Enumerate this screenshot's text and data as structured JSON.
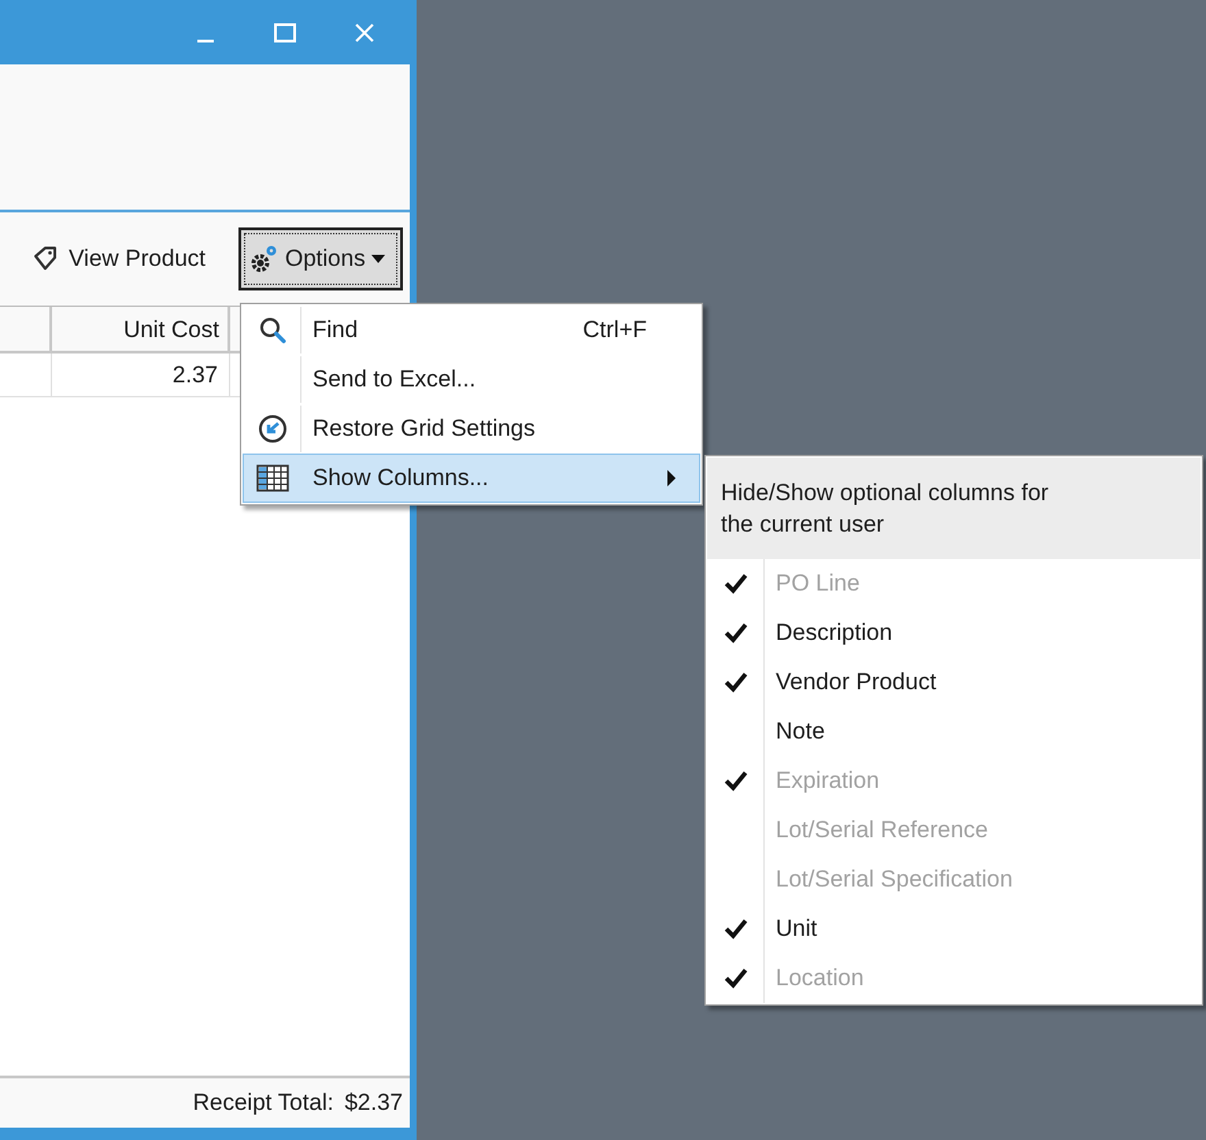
{
  "window": {
    "buttons": [
      {
        "kind": "minimize"
      },
      {
        "kind": "maximize"
      },
      {
        "kind": "close"
      }
    ]
  },
  "toolbar": {
    "view_product": "View Product",
    "options": "Options"
  },
  "grid": {
    "columns": [
      "Unit Cost"
    ],
    "rows": [
      [
        "2.37"
      ]
    ]
  },
  "status_bar": {
    "label": "Receipt Total:",
    "value": "$2.37"
  },
  "options_menu": [
    {
      "kind": "find",
      "label": "Find",
      "shortcut": "Ctrl+F",
      "selected": false,
      "submenu": false
    },
    {
      "kind": "none",
      "label": "Send to Excel...",
      "selected": false,
      "submenu": false
    },
    {
      "kind": "restore",
      "label": "Restore Grid Settings",
      "selected": false,
      "submenu": false
    },
    {
      "kind": "columns",
      "label": "Show Columns...",
      "selected": true,
      "submenu": true
    }
  ],
  "columns_menu": {
    "header": "Hide/Show optional columns for the current user",
    "items": [
      {
        "label": "PO Line",
        "checked": true,
        "disabled": true
      },
      {
        "label": "Description",
        "checked": true,
        "disabled": false
      },
      {
        "label": "Vendor Product",
        "checked": true,
        "disabled": false
      },
      {
        "label": "Note",
        "checked": false,
        "disabled": false
      },
      {
        "label": "Expiration",
        "checked": true,
        "disabled": true
      },
      {
        "label": "Lot/Serial Reference",
        "checked": false,
        "disabled": true
      },
      {
        "label": "Lot/Serial Specification",
        "checked": false,
        "disabled": true
      },
      {
        "label": "Unit",
        "checked": true,
        "disabled": false
      },
      {
        "label": "Location",
        "checked": true,
        "disabled": true
      }
    ]
  }
}
